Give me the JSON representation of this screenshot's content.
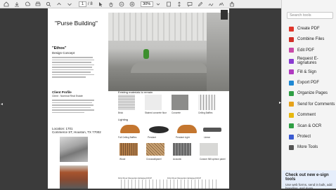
{
  "toolbar": {
    "page_current": "1",
    "page_total": "/ 8",
    "zoom": "30%"
  },
  "sidebar": {
    "search_placeholder": "Search tools",
    "tools": [
      {
        "label": "Create PDF",
        "color": "#e0362b"
      },
      {
        "label": "Combine Files",
        "color": "#d12f28"
      },
      {
        "label": "Edit PDF",
        "color": "#c94aa8"
      },
      {
        "label": "Request E-signatures",
        "color": "#8a3bd1"
      },
      {
        "label": "Fill & Sign",
        "color": "#b03ac0"
      },
      {
        "label": "Export PDF",
        "color": "#1e88d3"
      },
      {
        "label": "Organize Pages",
        "color": "#2f9e44"
      },
      {
        "label": "Send for Comments",
        "color": "#e6a21a"
      },
      {
        "label": "Comment",
        "color": "#e7b80f"
      },
      {
        "label": "Scan & OCR",
        "color": "#2f9e44"
      },
      {
        "label": "Protect",
        "color": "#3b5bd1"
      },
      {
        "label": "More Tools",
        "color": "#555555"
      }
    ],
    "promo_title": "Check out new e-sign tools",
    "promo_text": "Use web forms, send in bulk, add branding, and more."
  },
  "document": {
    "title": "\"Purse Building\"",
    "ethos_heading": "\"Ethos\"",
    "concept_heading": "Design Concept",
    "client_heading": "Client Profile",
    "client_sub": "Client : Nominal Real Estate",
    "location_line1": "Location: 1701",
    "location_line2": "Commerce ST, Houston, TX 77002",
    "materials_heading": "Existing materials to remain",
    "lighting_heading": "Lighting",
    "materials": [
      "Brick",
      "Stained concrete floor",
      "Concrete",
      "Ceiling Baffles"
    ],
    "lights": [
      "Full Ceiling Baffles",
      "Pendant",
      "Pendant Light",
      "Linear"
    ],
    "acoustics": [
      "Wood",
      "Crosswallpanel",
      "Acoustic",
      "Custom Mill opinion panel"
    ],
    "plan_labels": [
      "First Floor Reception Enlarged RCP",
      "First Floor Reception Enlarged RCP"
    ]
  },
  "colors": {
    "sidebar_bg": "#f4f4f4",
    "toolbar_bg": "#ededed",
    "canvas_bg": "#3b3b3b",
    "promo_bg": "#e6eefb"
  }
}
